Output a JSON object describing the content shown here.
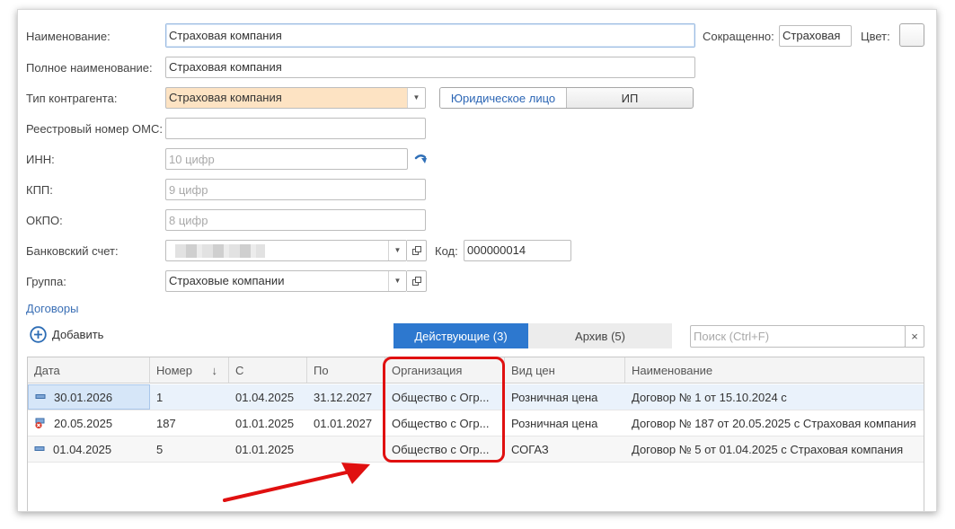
{
  "form": {
    "name_label": "Наименование:",
    "name_value": "Страховая компания",
    "short_label": "Сокращенно:",
    "short_value": "Страховая",
    "color_label": "Цвет:",
    "fullname_label": "Полное наименование:",
    "fullname_value": "Страховая компания",
    "type_label": "Тип контрагента:",
    "type_value": "Страховая компания",
    "legal_options": [
      "Юридическое лицо",
      "ИП"
    ],
    "legal_selected": "Юридическое лицо",
    "oms_label": "Реестровый номер ОМС:",
    "oms_value": "",
    "inn_label": "ИНН:",
    "inn_placeholder": "10 цифр",
    "kpp_label": "КПП:",
    "kpp_placeholder": "9 цифр",
    "okpo_label": "ОКПО:",
    "okpo_placeholder": "8 цифр",
    "bank_label": "Банковский счет:",
    "code_label": "Код:",
    "code_value": "000000014",
    "group_label": "Группа:",
    "group_value": "Страховые компании"
  },
  "contracts": {
    "section_link": "Договоры",
    "add_label": "Добавить",
    "tabs": [
      {
        "label": "Действующие (3)",
        "active": true
      },
      {
        "label": "Архив (5)",
        "active": false
      }
    ],
    "search_placeholder": "Поиск (Ctrl+F)",
    "clear_symbol": "×",
    "columns": [
      "Дата",
      "Номер",
      "С",
      "По",
      "Организация",
      "Вид цен",
      "Наименование"
    ],
    "sort_indicator": "↓",
    "rows": [
      {
        "date": "30.01.2026",
        "number": "1",
        "from": "01.04.2025",
        "to": "31.12.2027",
        "org": "Общество с Огр...",
        "price_type": "Розничная цена",
        "name": "Договор № 1 от 15.10.2024 с",
        "status_icon": "active-doc-icon"
      },
      {
        "date": "20.05.2025",
        "number": "187",
        "from": "01.01.2025",
        "to": "01.01.2027",
        "org": "Общество с Огр...",
        "price_type": "Розничная цена",
        "name": "Договор № 187 от 20.05.2025 с Страховая компания",
        "status_icon": "deleted-doc-icon"
      },
      {
        "date": "01.04.2025",
        "number": "5",
        "from": "01.01.2025",
        "to": "",
        "org": "Общество с Огр...",
        "price_type": "СОГАЗ",
        "name": "Договор № 5 от 01.04.2025 с Страховая компания",
        "status_icon": "active-doc-icon"
      }
    ]
  },
  "colors": {
    "accent": "#2d78cf",
    "link": "#3a6fb5",
    "type_field_bg": "#fde3c3",
    "annotation": "#e01010",
    "selected_row": "#eaf2fb"
  }
}
